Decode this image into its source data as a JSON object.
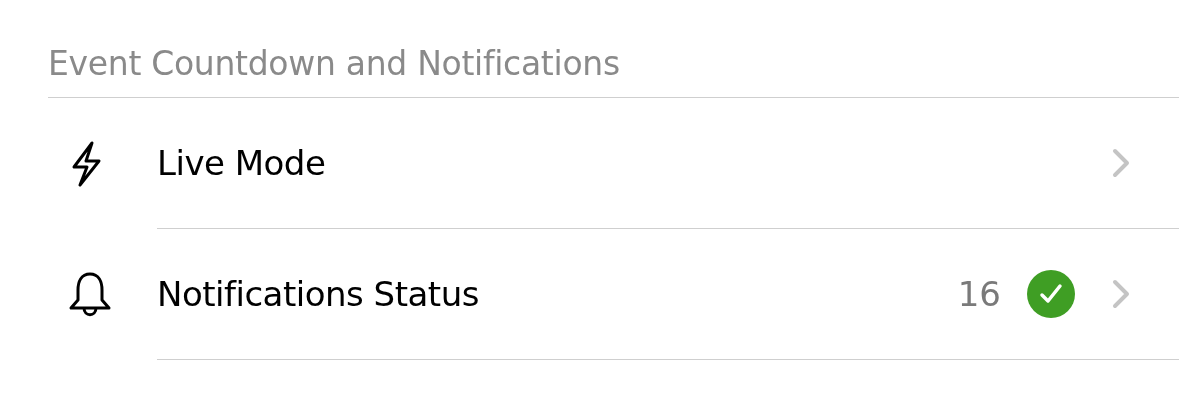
{
  "section": {
    "title": "Event Countdown and Notifications"
  },
  "rows": [
    {
      "kind": "plain",
      "label": "Live Mode"
    },
    {
      "kind": "status",
      "label": "Notifications Status",
      "count": "16",
      "ok": true
    }
  ]
}
